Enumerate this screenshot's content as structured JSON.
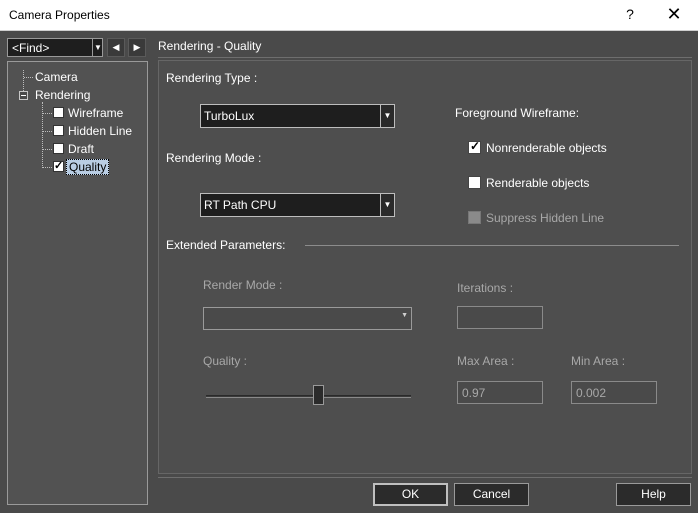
{
  "window": {
    "title": "Camera Properties",
    "help_glyph": "?",
    "close_glyph": "✕"
  },
  "find": {
    "value": "<Find>",
    "dropdown_glyph": "▼",
    "prev_glyph": "◀",
    "next_glyph": "▶"
  },
  "tree": {
    "camera": "Camera",
    "rendering": "Rendering",
    "children": [
      {
        "label": "Wireframe",
        "checked": false
      },
      {
        "label": "Hidden Line",
        "checked": false
      },
      {
        "label": "Draft",
        "checked": false
      },
      {
        "label": "Quality",
        "checked": true,
        "selected": true
      }
    ]
  },
  "panel": {
    "header": "Rendering - Quality",
    "rendering_type_label": "Rendering Type :",
    "rendering_type_value": "TurboLux",
    "rendering_mode_label": "Rendering Mode :",
    "rendering_mode_value": "RT Path CPU",
    "dropdown_glyph": "▼",
    "foreground_wireframe_label": "Foreground Wireframe:",
    "nonrenderable_label": "Nonrenderable objects",
    "nonrenderable_checked": true,
    "renderable_label": "Renderable objects",
    "renderable_checked": false,
    "suppress_label": "Suppress Hidden Line",
    "suppress_checked": false,
    "extended_label": "Extended Parameters:",
    "render_mode_label": "Render Mode :",
    "render_mode_value": "",
    "iterations_label": "Iterations :",
    "iterations_value": "",
    "quality_label": "Quality :",
    "quality_slider_fraction": 0.55,
    "max_area_label": "Max Area :",
    "max_area_value": "0.97",
    "min_area_label": "Min Area :",
    "min_area_value": "0.002"
  },
  "buttons": {
    "ok": "OK",
    "cancel": "Cancel",
    "help": "Help"
  },
  "colors": {
    "background": "#4a4a4a",
    "selection": "#b9cde3"
  }
}
